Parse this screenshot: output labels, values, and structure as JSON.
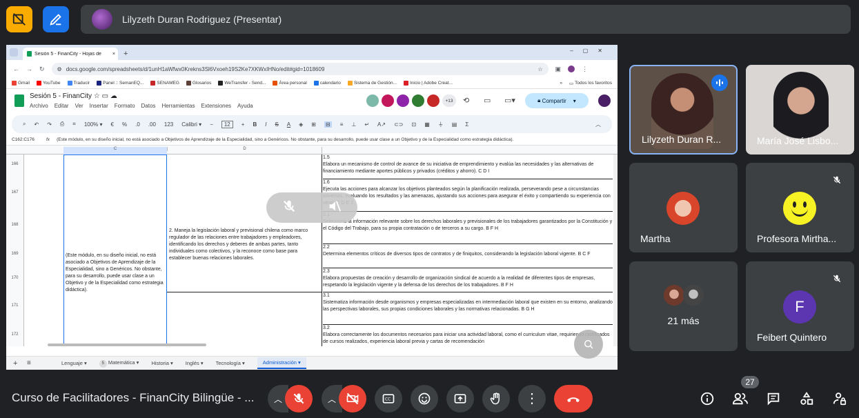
{
  "top": {
    "presenter_name": "Lilyzeth Duran Rodriguez (Presentar)"
  },
  "browser": {
    "tab_title": "Sesión 5 - FinanCity - Hojas de",
    "url": "docs.google.com/spreadsheets/d/1unH1aWfwx0Krekns3Sl6Vxoeh19S2Ke7XKWxIHNo/edit#gid=1018609",
    "bookmarks": [
      "Gmail",
      "YouTube",
      "Traducir",
      "Panel :: SemanEQ...",
      "SENAMEG",
      "Glosarios",
      "WeTransfer - Send...",
      "Área personal",
      "calendario",
      "Sistema de Gestión...",
      "Inicio | Adobe Creat..."
    ],
    "bookmark_folder": "Todos los favoritos"
  },
  "sheet": {
    "title": "Sesión 5 - FinanCity",
    "menus": [
      "Archivo",
      "Editar",
      "Ver",
      "Insertar",
      "Formato",
      "Datos",
      "Herramientas",
      "Extensiones",
      "Ayuda"
    ],
    "share_label": "Compartir",
    "collab_extra": "+13",
    "zoom": "100%",
    "font": "Calibri",
    "font_size": "12",
    "cell_ref": "C162:C176",
    "formula": "(Este módulo, en su diseño inicial, no está asociado a Objetivos de Aprendizaje de la Especialidad, sino a Genéricos. No obstante, para su desarrollo, puede usar clase a un Objetivo y de la Especialidad como estrategia didáctica).",
    "col_c": "C",
    "col_d": "D",
    "rows": [
      "166",
      "167",
      "168",
      "169",
      "170",
      "171",
      "172"
    ],
    "merged_c": "(Este módulo, en su diseño inicial, no está asociado a Objetivos de Aprendizaje de la Especialidad, sino a Genéricos. No obstante, para su desarrollo, puede usar clase a un Objetivo y de la Especialidad como estrategia didáctica).",
    "merged_d": "2. Maneja la legislación laboral y previsional chilena como marco regulador de las relaciones entre trabajadores y empleadores, identificando los derechos y deberes de ambas partes, tanto individuales como colectivos, y la reconoce como base para establecer buenas relaciones laborales.",
    "e_cells": [
      {
        "num": "1.5",
        "text": "Elabora un mecanismo de control de avance de su iniciativa de emprendimiento y evalúa las necesidades y las alternativas de financiamiento mediante aportes públicos y privados (créditos y ahorro). C D I"
      },
      {
        "num": "1.6",
        "text": "Ejecuta las acciones para alcanzar los objetivos planteados según la planificación realizada, perseverando pese a circunstancias adversas, evaluando los resultados y las amenazas, ajustando sus acciones para asegurar el éxito y compartiendo su experiencia con otros. C D E J"
      },
      {
        "num": "2.1",
        "text": "Selecciona la información relevante sobre los derechos laborales y previsionales de los trabajadores garantizados por la Constitución y el Código del Trabajo, para su propia contratación o de terceros a su cargo. B F H"
      },
      {
        "num": "2.2",
        "text": "Determina elementos críticos de diversos tipos de contratos y de finiquitos, considerando la legislación laboral vigente. B C F"
      },
      {
        "num": "2.3",
        "text": "Elabora propuestas de creación y desarrollo de organización sindical de acuerdo a la realidad de diferentes tipos de empresas, respetando la legislación vigente y la defensa de los derechos de los trabajadores. B F H"
      },
      {
        "num": "3.1",
        "text": "Sistematiza información desde organismos y empresas especializadas en intermediación laboral que existen en su entorno, analizando las perspectivas laborales, sus propias condiciones laborales y las normativas relacionadas. B G H"
      },
      {
        "num": "3.2",
        "text": "Elabora correctamente los documentos necesarios para iniciar una actividad laboral, como el curriculum vitae, requiriendo certificados de cursos realizados, experiencia laboral previa y cartas de recomendación"
      }
    ],
    "tabs": [
      "Lenguaje",
      "Matemática",
      "Historia",
      "Inglés",
      "Tecnología",
      "Administración"
    ],
    "tab_badge": "5"
  },
  "participants": [
    {
      "name": "Lilyzeth Duran R..."
    },
    {
      "name": "María José Lisbo..."
    },
    {
      "name": "Martha"
    },
    {
      "name": "Profesora Mirtha..."
    },
    {
      "name": "21 más"
    },
    {
      "name": "Feibert Quintero",
      "initial": "F"
    }
  ],
  "bottom": {
    "meeting_title": "Curso de Facilitadores - FinanCity Bilingüe - ...",
    "people_count": "27"
  },
  "colors": {
    "accent": "#1a73e8",
    "danger": "#ea4335",
    "bg": "#202124",
    "tile": "#3c4043"
  }
}
